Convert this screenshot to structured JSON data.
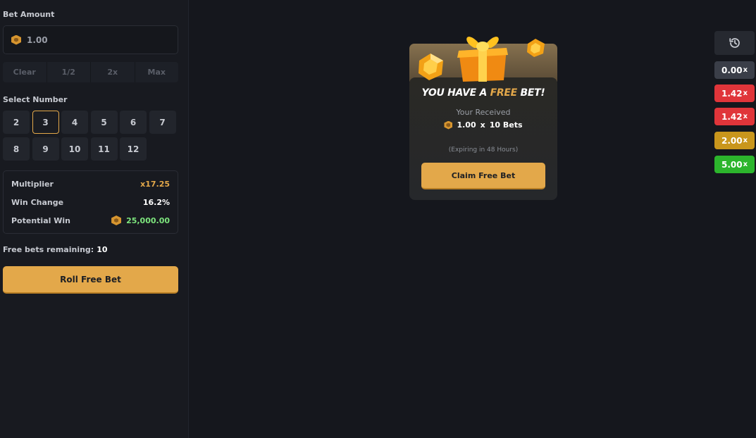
{
  "sidebar": {
    "bet_amount_label": "Bet Amount",
    "bet_amount_value": "1.00",
    "quick_buttons": [
      "Clear",
      "1/2",
      "2x",
      "Max"
    ],
    "select_number_label": "Select Number",
    "numbers": [
      "2",
      "3",
      "4",
      "5",
      "6",
      "7",
      "8",
      "9",
      "10",
      "11",
      "12"
    ],
    "selected_number": "3",
    "stats": {
      "multiplier_label": "Multiplier",
      "multiplier_value": "x17.25",
      "win_change_label": "Win Change",
      "win_change_value": "16.2%",
      "potential_win_label": "Potential Win",
      "potential_win_value": "25,000.00"
    },
    "free_bets_label": "Free bets remaining:",
    "free_bets_value": "10",
    "roll_button_label": "Roll Free Bet"
  },
  "modal": {
    "title_prefix": "YOU HAVE A ",
    "title_highlight": "FREE",
    "title_suffix": " BET!",
    "received_label": "Your Received",
    "amount": "1.00",
    "times": "x",
    "bets": "10 Bets",
    "expiry": "(Expiring in 48 Hours)",
    "claim_button_label": "Claim Free Bet"
  },
  "history": {
    "icon": "history-icon",
    "items": [
      {
        "value": "0.00",
        "suffix": "x",
        "color": "#3a3e48"
      },
      {
        "value": "1.42",
        "suffix": "x",
        "color": "#e0353a"
      },
      {
        "value": "1.42",
        "suffix": "x",
        "color": "#e0353a"
      },
      {
        "value": "2.00",
        "suffix": "x",
        "color": "#c9961c"
      },
      {
        "value": "5.00",
        "suffix": "x",
        "color": "#2cb52c"
      }
    ]
  },
  "colors": {
    "accent": "#e3a84a",
    "background": "#15171d",
    "sidebar": "#181a20",
    "win_green": "#7de57d"
  }
}
